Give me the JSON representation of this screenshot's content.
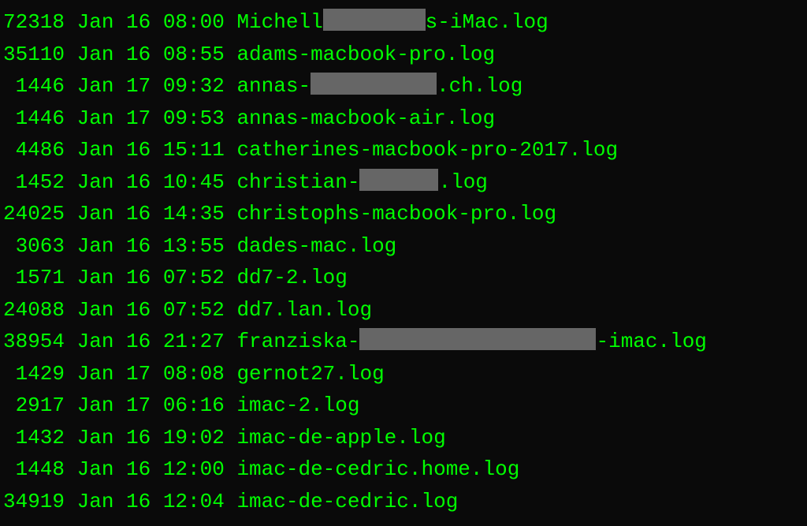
{
  "rows": [
    {
      "size": "72318",
      "date": "Jan 16 08:00",
      "file_pre": "Michell",
      "file_post": "s-iMac.log",
      "redact": "r1"
    },
    {
      "size": "35110",
      "date": "Jan 16 08:55",
      "file_pre": "adams-macbook-pro.log",
      "file_post": "",
      "redact": ""
    },
    {
      "size": "1446",
      "date": "Jan 17 09:32",
      "file_pre": "annas-",
      "file_post": ".ch.log",
      "redact": "r2"
    },
    {
      "size": "1446",
      "date": "Jan 17 09:53",
      "file_pre": "annas-macbook-air.log",
      "file_post": "",
      "redact": ""
    },
    {
      "size": "4486",
      "date": "Jan 16 15:11",
      "file_pre": "catherines-macbook-pro-2017.log",
      "file_post": "",
      "redact": ""
    },
    {
      "size": "1452",
      "date": "Jan 16 10:45",
      "file_pre": "christian-",
      "file_post": ".log",
      "redact": "r3"
    },
    {
      "size": "24025",
      "date": "Jan 16 14:35",
      "file_pre": "christophs-macbook-pro.log",
      "file_post": "",
      "redact": ""
    },
    {
      "size": "3063",
      "date": "Jan 16 13:55",
      "file_pre": "dades-mac.log",
      "file_post": "",
      "redact": ""
    },
    {
      "size": "1571",
      "date": "Jan 16 07:52",
      "file_pre": "dd7-2.log",
      "file_post": "",
      "redact": ""
    },
    {
      "size": "24088",
      "date": "Jan 16 07:52",
      "file_pre": "dd7.lan.log",
      "file_post": "",
      "redact": ""
    },
    {
      "size": "38954",
      "date": "Jan 16 21:27",
      "file_pre": "franziska-",
      "file_post": "-imac.log",
      "redact": "r4"
    },
    {
      "size": "1429",
      "date": "Jan 17 08:08",
      "file_pre": "gernot27.log",
      "file_post": "",
      "redact": ""
    },
    {
      "size": "2917",
      "date": "Jan 17 06:16",
      "file_pre": "imac-2.log",
      "file_post": "",
      "redact": ""
    },
    {
      "size": "1432",
      "date": "Jan 16 19:02",
      "file_pre": "imac-de-apple.log",
      "file_post": "",
      "redact": ""
    },
    {
      "size": "1448",
      "date": "Jan 16 12:00",
      "file_pre": "imac-de-cedric.home.log",
      "file_post": "",
      "redact": ""
    },
    {
      "size": "34919",
      "date": "Jan 16 12:04",
      "file_pre": "imac-de-cedric.log",
      "file_post": "",
      "redact": ""
    }
  ]
}
